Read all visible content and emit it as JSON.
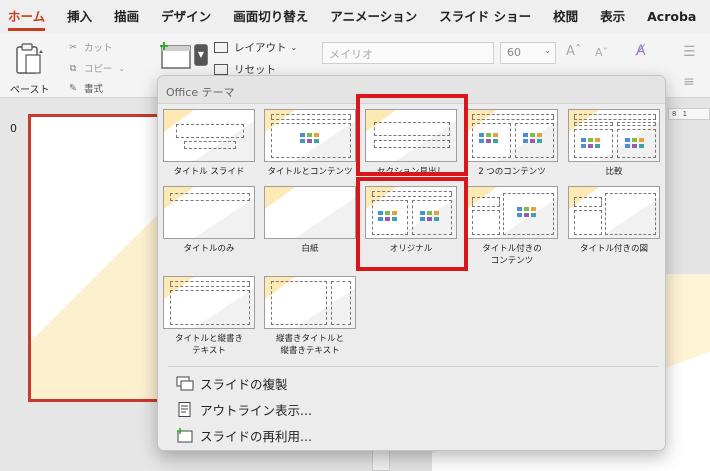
{
  "ribbon": {
    "tabs": [
      "ホーム",
      "挿入",
      "描画",
      "デザイン",
      "画面切り替え",
      "アニメーション",
      "スライド ショー",
      "校閲",
      "表示",
      "Acroba"
    ],
    "active_tab_index": 0
  },
  "clipboard": {
    "paste_label": "ペースト",
    "cut_label": "カット",
    "copy_label": "コピー",
    "format_label": "書式"
  },
  "slides_group": {
    "layout_label": "レイアウト",
    "reset_label": "リセット"
  },
  "font": {
    "name_value": "メイリオ",
    "size_value": "60",
    "grow_label": "Aˆ",
    "shrink_label": "Aˇ"
  },
  "thumbnails": {
    "slide_number": "0"
  },
  "ruler_text": "8  1",
  "gallery": {
    "header": "Office テーマ",
    "layouts": [
      {
        "label": "タイトル スライド",
        "variant": "title"
      },
      {
        "label": "タイトルとコンテンツ",
        "variant": "content"
      },
      {
        "label": "セクション見出し",
        "variant": "section"
      },
      {
        "label": "2 つのコンテンツ",
        "variant": "two"
      },
      {
        "label": "比較",
        "variant": "compare"
      },
      {
        "label": "タイトルのみ",
        "variant": "titleonly"
      },
      {
        "label": "白紙",
        "variant": "blank"
      },
      {
        "label": "オリジナル",
        "variant": "original"
      },
      {
        "label": "タイトル付きの\nコンテンツ",
        "variant": "captioned"
      },
      {
        "label": "タイトル付きの図",
        "variant": "picture"
      },
      {
        "label": "タイトルと縦書き\nテキスト",
        "variant": "vertical"
      },
      {
        "label": "縦書きタイトルと\n縦書きテキスト",
        "variant": "vvertical"
      }
    ],
    "menu": {
      "duplicate_label": "スライドの複製",
      "outline_label": "アウトライン表示...",
      "reuse_label": "スライドの再利用..."
    }
  },
  "colors": {
    "accent": "#c43e1c",
    "highlight": "#d9161c",
    "thumb_border": "#c53a2c",
    "theme_wedge": "#fde9b4"
  }
}
